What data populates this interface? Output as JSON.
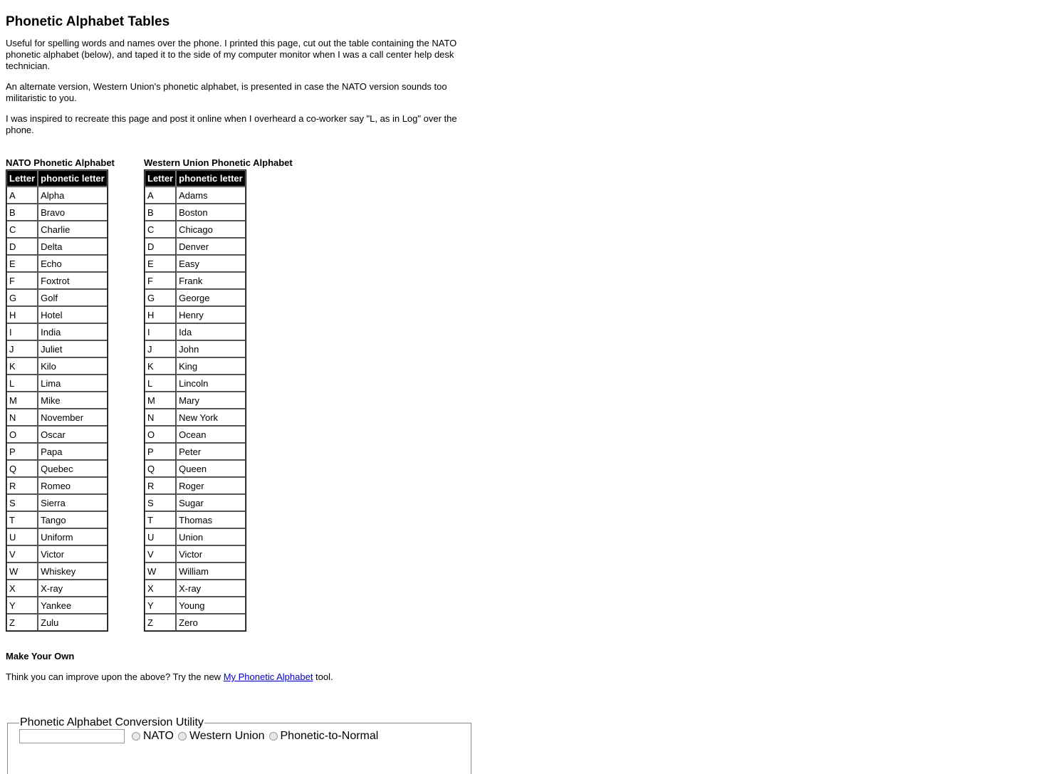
{
  "page": {
    "title": "Phonetic Alphabet Tables",
    "paragraphs": [
      "Useful for spelling words and names over the phone. I printed this page, cut out the table containing the NATO phonetic alphabet (below), and taped it to the side of my computer monitor when I was a call center help desk technician.",
      "An alternate version, Western Union's phonetic alphabet, is presented in case the NATO version sounds too militaristic to you.",
      "I was inspired to recreate this page and post it online when I overheard a co-worker say \"L, as in Log\" over the phone."
    ]
  },
  "tables": [
    {
      "title": "NATO Phonetic Alphabet",
      "headers": [
        "Letter",
        "phonetic letter"
      ],
      "rows": [
        [
          "A",
          "Alpha"
        ],
        [
          "B",
          "Bravo"
        ],
        [
          "C",
          "Charlie"
        ],
        [
          "D",
          "Delta"
        ],
        [
          "E",
          "Echo"
        ],
        [
          "F",
          "Foxtrot"
        ],
        [
          "G",
          "Golf"
        ],
        [
          "H",
          "Hotel"
        ],
        [
          "I",
          "India"
        ],
        [
          "J",
          "Juliet"
        ],
        [
          "K",
          "Kilo"
        ],
        [
          "L",
          "Lima"
        ],
        [
          "M",
          "Mike"
        ],
        [
          "N",
          "November"
        ],
        [
          "O",
          "Oscar"
        ],
        [
          "P",
          "Papa"
        ],
        [
          "Q",
          "Quebec"
        ],
        [
          "R",
          "Romeo"
        ],
        [
          "S",
          "Sierra"
        ],
        [
          "T",
          "Tango"
        ],
        [
          "U",
          "Uniform"
        ],
        [
          "V",
          "Victor"
        ],
        [
          "W",
          "Whiskey"
        ],
        [
          "X",
          "X-ray"
        ],
        [
          "Y",
          "Yankee"
        ],
        [
          "Z",
          "Zulu"
        ]
      ]
    },
    {
      "title": "Western Union Phonetic Alphabet",
      "headers": [
        "Letter",
        "phonetic letter"
      ],
      "rows": [
        [
          "A",
          "Adams"
        ],
        [
          "B",
          "Boston"
        ],
        [
          "C",
          "Chicago"
        ],
        [
          "D",
          "Denver"
        ],
        [
          "E",
          "Easy"
        ],
        [
          "F",
          "Frank"
        ],
        [
          "G",
          "George"
        ],
        [
          "H",
          "Henry"
        ],
        [
          "I",
          "Ida"
        ],
        [
          "J",
          "John"
        ],
        [
          "K",
          "King"
        ],
        [
          "L",
          "Lincoln"
        ],
        [
          "M",
          "Mary"
        ],
        [
          "N",
          "New York"
        ],
        [
          "O",
          "Ocean"
        ],
        [
          "P",
          "Peter"
        ],
        [
          "Q",
          "Queen"
        ],
        [
          "R",
          "Roger"
        ],
        [
          "S",
          "Sugar"
        ],
        [
          "T",
          "Thomas"
        ],
        [
          "U",
          "Union"
        ],
        [
          "V",
          "Victor"
        ],
        [
          "W",
          "William"
        ],
        [
          "X",
          "X-ray"
        ],
        [
          "Y",
          "Young"
        ],
        [
          "Z",
          "Zero"
        ]
      ]
    }
  ],
  "make_own": {
    "heading": "Make Your Own",
    "text_before": "Think you can improve upon the above? Try the new ",
    "link_label": "My Phonetic Alphabet",
    "text_after": " tool."
  },
  "utility": {
    "legend": "Phonetic Alphabet Conversion Utility",
    "input_value": "",
    "options": [
      "NATO",
      "Western Union",
      "Phonetic-to-Normal"
    ]
  },
  "colors": {
    "link": "#0000cc",
    "header_bg": "#000000",
    "header_text": "#ffffff"
  }
}
